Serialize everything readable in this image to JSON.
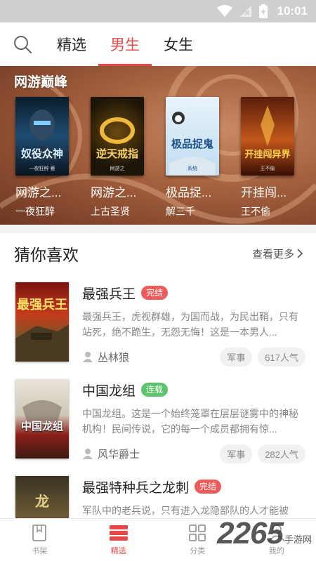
{
  "status": {
    "time": "10:01"
  },
  "tabs": [
    {
      "label": "精选",
      "active": false
    },
    {
      "label": "男生",
      "active": true
    },
    {
      "label": "女生",
      "active": false
    }
  ],
  "banner": {
    "title": "网游巅峰",
    "books": [
      {
        "title": "网游之...",
        "author": "一夜狂醉",
        "cover_text": "奴役众神",
        "cover_sub": "一夜狂醉 著"
      },
      {
        "title": "网游之...",
        "author": "上古圣贤",
        "cover_text": "逆天戒指",
        "cover_sub": "网游之"
      },
      {
        "title": "极品捉...",
        "author": "解三千",
        "cover_text": "极品捉鬼",
        "cover_sub": "系统"
      },
      {
        "title": "开挂闯...",
        "author": "王不偷",
        "cover_text": "开挂闯异界",
        "cover_sub": "王不偷"
      }
    ]
  },
  "section": {
    "title": "猜你喜欢",
    "more": "查看更多"
  },
  "books": [
    {
      "name": "最强兵王",
      "status": "完结",
      "status_type": "done",
      "desc": "最强兵王，虎视群雄，为国而战，为民出鞘，只有站死，绝不跪生，无怨无悔！这是一本男人...",
      "author": "丛林狼",
      "tag": "军事",
      "popularity": "617人气",
      "cover_text": "最强兵王"
    },
    {
      "name": "中国龙组",
      "status": "连载",
      "status_type": "ongoing",
      "desc": "中国龙组。这是一个始终笼罩在层层谜雾中的神秘机构！民间传说，它的每一个成员都拥有惊...",
      "author": "风华爵士",
      "tag": "军事",
      "popularity": "282人气",
      "cover_text": "中国龙组"
    },
    {
      "name": "最强特种兵之龙刺",
      "status": "完结",
      "status_type": "done",
      "desc": "军队中的老兵说，只有进入龙隐部队的人才能被",
      "author": "",
      "tag": "",
      "popularity": "",
      "cover_text": "龙"
    }
  ],
  "bottom_nav": [
    {
      "label": "书架",
      "icon": "book-icon",
      "active": false
    },
    {
      "label": "精选",
      "icon": "stack-icon",
      "active": true
    },
    {
      "label": "分类",
      "icon": "grid-icon",
      "active": false
    },
    {
      "label": "我的",
      "icon": "person-icon",
      "active": false
    }
  ],
  "watermark": {
    "number": "2265",
    "text": "手游网"
  },
  "colors": {
    "accent": "#e64848",
    "done_badge": "#ef5b5b",
    "ongoing_badge": "#5cc46b"
  }
}
